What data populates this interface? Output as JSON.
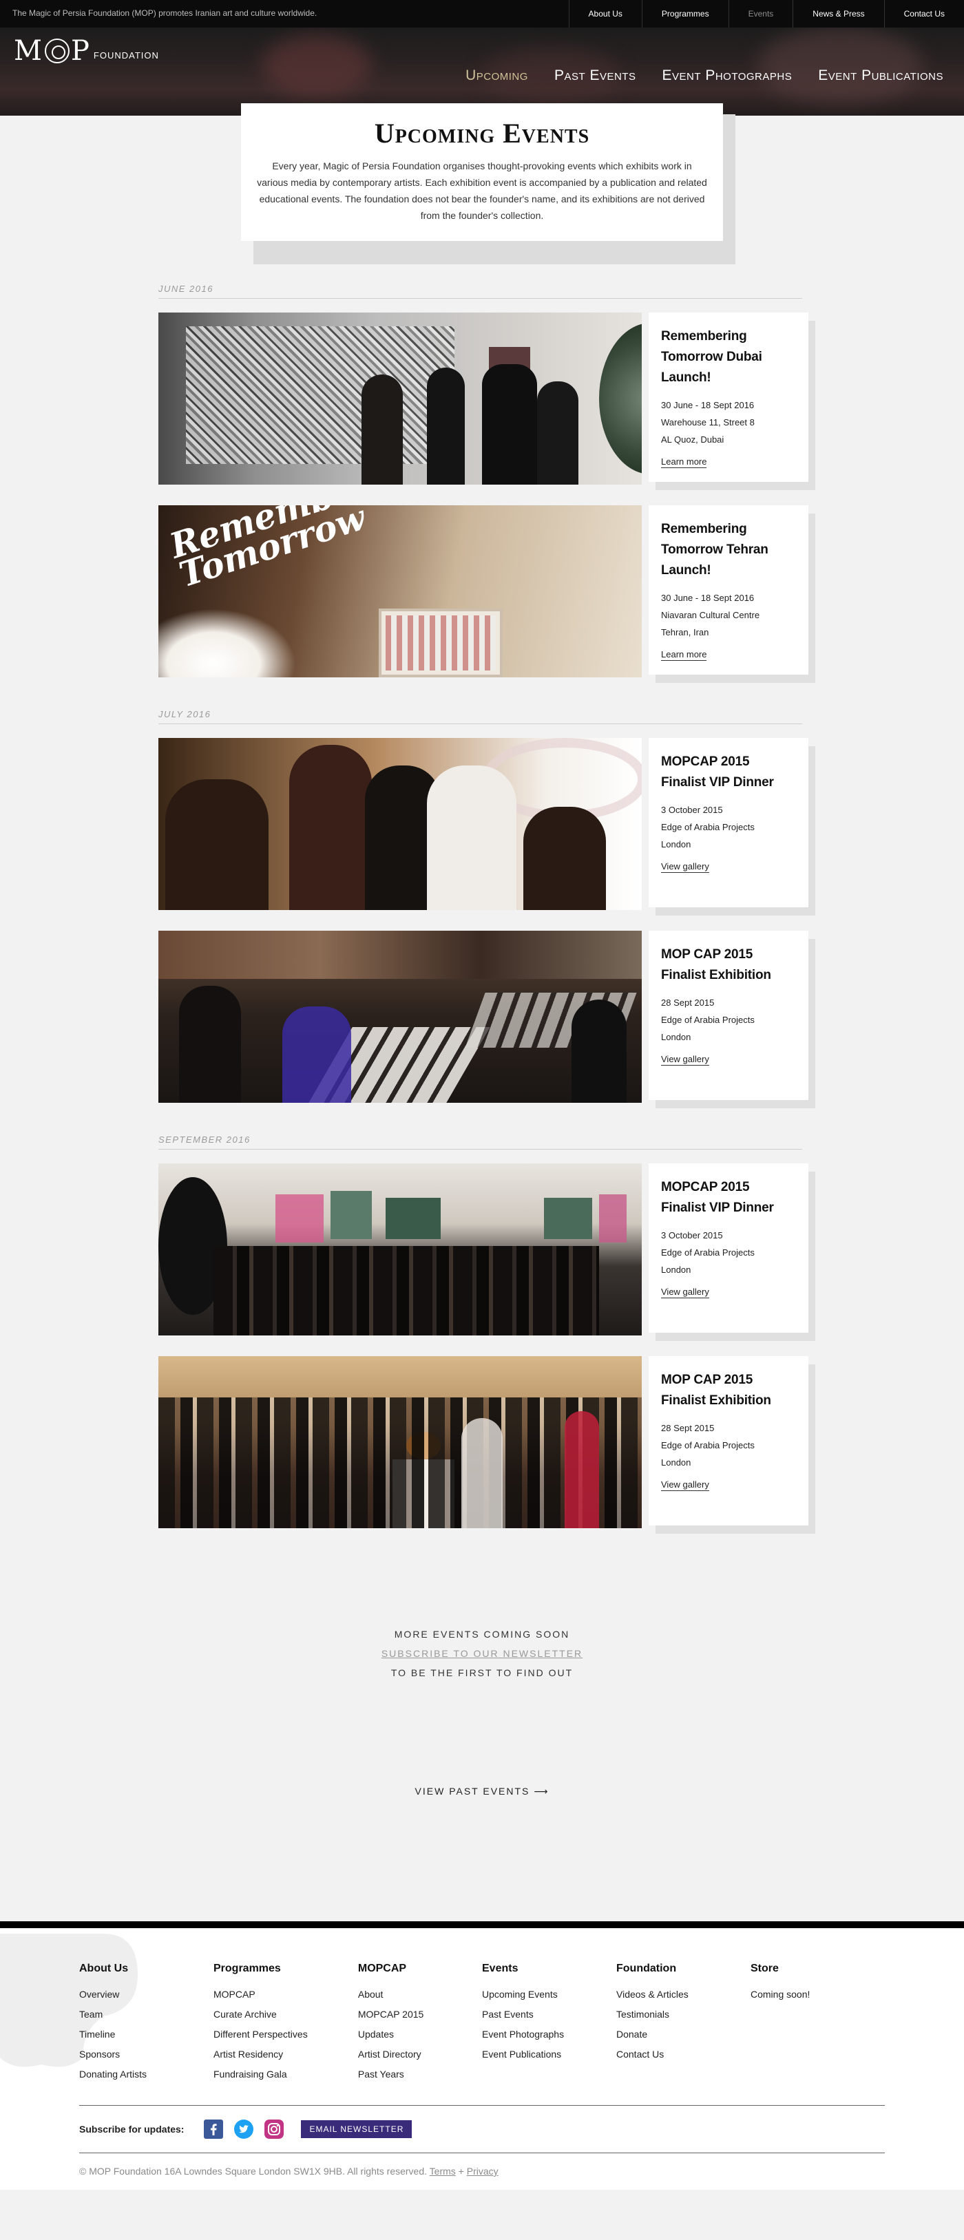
{
  "topbar": {
    "tagline": "The Magic of Persia Foundation (MOP) promotes Iranian art and culture worldwide.",
    "links": [
      "About Us",
      "Programmes",
      "Events",
      "News & Press",
      "Contact Us"
    ]
  },
  "logo": {
    "mop": "MOP",
    "foundation": "FOUNDATION"
  },
  "mainnav": [
    "Upcoming",
    "Past Events",
    "Event Photographs",
    "Event Publications"
  ],
  "intro": {
    "title": "Upcoming Events",
    "text": "Every year, Magic of Persia Foundation organises thought-provoking events which exhibits work in various media by contemporary artists. Each exhibition event is accompanied by a publication and related educational events. The foundation does not bear the founder's name, and its exhibitions are not derived from the founder's collection."
  },
  "months": [
    {
      "label": "JUNE 2016",
      "events": [
        {
          "title": "Remembering Tomorrow Dubai Launch!",
          "date": "30 June - 18 Sept 2016",
          "loc1": "Warehouse 11, Street 8",
          "loc2": "AL Quoz, Dubai",
          "link": "Learn more"
        },
        {
          "title": "Remembering Tomorrow Tehran Launch!",
          "date": "30 June - 18 Sept 2016",
          "loc1": "Niavaran Cultural Centre",
          "loc2": "Tehran, Iran",
          "link": "Learn more"
        }
      ]
    },
    {
      "label": "JULY 2016",
      "events": [
        {
          "title": "MOPCAP 2015 Finalist VIP Dinner",
          "date": "3 October 2015",
          "loc1": "Edge of Arabia Projects",
          "loc2": "London",
          "link": "View gallery"
        },
        {
          "title": "MOP CAP 2015 Finalist Exhibition",
          "date": "28 Sept 2015",
          "loc1": "Edge of Arabia Projects",
          "loc2": "London",
          "link": "View gallery"
        }
      ]
    },
    {
      "label": "SEPTEMBER 2016",
      "events": [
        {
          "title": "MOPCAP 2015 Finalist VIP Dinner",
          "date": "3 October 2015",
          "loc1": "Edge of Arabia Projects",
          "loc2": "London",
          "link": "View gallery"
        },
        {
          "title": "MOP CAP 2015 Finalist Exhibition",
          "date": "28 Sept 2015",
          "loc1": "Edge of Arabia Projects",
          "loc2": "London",
          "link": "View gallery"
        }
      ]
    }
  ],
  "photo_text": {
    "remembering_art": "Remembering Tomorrow"
  },
  "soon": {
    "line1": "MORE EVENTS COMING SOON",
    "link": "SUBSCRIBE TO OUR NEWSLETTER",
    "line3": "TO BE THE FIRST TO FIND OUT"
  },
  "past_link": "VIEW PAST EVENTS",
  "footer": {
    "columns": [
      {
        "title": "About Us",
        "items": [
          "Overview",
          "Team",
          "Timeline",
          "Sponsors",
          "Donating Artists"
        ]
      },
      {
        "title": "Programmes",
        "items": [
          "MOPCAP",
          "Curate Archive",
          "Different Perspectives",
          "Artist Residency",
          "Fundraising Gala"
        ]
      },
      {
        "title": "MOPCAP",
        "items": [
          "About",
          "MOPCAP 2015",
          "Updates",
          "Artist Directory",
          "Past Years"
        ]
      },
      {
        "title": "Events",
        "items": [
          "Upcoming Events",
          "Past Events",
          "Event Photographs",
          "Event Publications"
        ]
      },
      {
        "title": "Foundation",
        "items": [
          "Videos & Articles",
          "Testimonials",
          "Donate",
          "Contact Us"
        ]
      },
      {
        "title": "Store",
        "items": [
          "Coming soon!"
        ]
      }
    ],
    "subscribe_label": "Subscribe for updates:",
    "newsletter_button": "EMAIL NEWSLETTER",
    "copyright": "© MOP Foundation 16A Lowndes Square London SW1X 9HB. All rights reserved.",
    "terms": "Terms",
    "plus": "+",
    "privacy": "Privacy"
  },
  "colors": {
    "accent_nav_active": "#cfc39a",
    "newsletter": "#3a2a7a",
    "facebook": "#3b5998",
    "twitter": "#1da1f2",
    "instagram": "#c13584"
  }
}
